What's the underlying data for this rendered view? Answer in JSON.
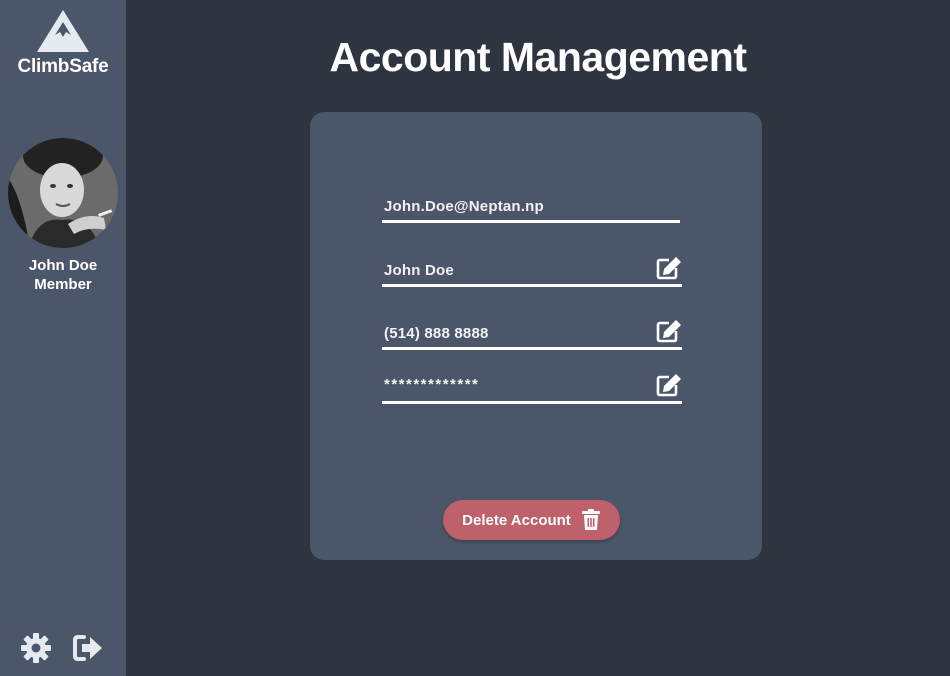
{
  "app": {
    "name": "ClimbSafe",
    "logo_icon": "mountain-icon"
  },
  "user": {
    "name": "John Doe",
    "role": "Member"
  },
  "page": {
    "title": "Account Management"
  },
  "account": {
    "email": "John.Doe@Neptan.np",
    "full_name": "John Doe",
    "phone": "(514) 888 8888",
    "password_masked": "*************"
  },
  "actions": {
    "delete_label": "Delete Account",
    "delete_icon": "trash-icon",
    "edit_icon": "edit-icon",
    "settings_icon": "gear-icon",
    "logout_icon": "logout-icon"
  },
  "colors": {
    "background": "#2e3440",
    "panel": "#4c566a",
    "danger": "#bf616a",
    "text": "#ffffff"
  }
}
